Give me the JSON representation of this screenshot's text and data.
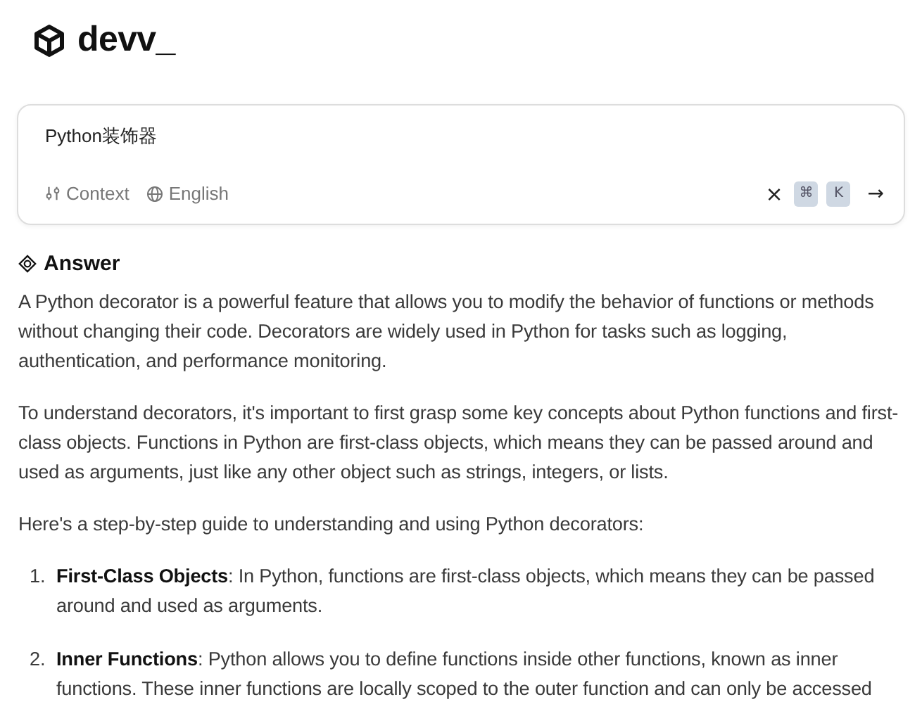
{
  "logo": {
    "text": "devv_"
  },
  "search": {
    "value": "Python装饰器",
    "context_label": "Context",
    "language_label": "English",
    "clear": "×",
    "shortcut_keys": [
      "⌘",
      "K"
    ],
    "submit": "→"
  },
  "answer": {
    "heading": "Answer",
    "paragraphs": [
      "A Python decorator is a powerful feature that allows you to modify the behavior of functions or methods without changing their code. Decorators are widely used in Python for tasks such as logging, authentication, and performance monitoring.",
      "To understand decorators, it's important to first grasp some key concepts about Python functions and first-class objects. Functions in Python are first-class objects, which means they can be passed around and used as arguments, just like any other object such as strings, integers, or lists.",
      "Here's a step-by-step guide to understanding and using Python decorators:"
    ],
    "steps": [
      {
        "number": "1.",
        "text": "**First-Class Objects**: In Python, functions are first-class objects, which means they can be passed around and used as arguments."
      },
      {
        "number": "2.",
        "text": "**Inner Functions**: Python allows you to define functions inside other functions, known as inner functions. These inner functions are locally scoped to the outer function and can only be accessed"
      }
    ]
  }
}
